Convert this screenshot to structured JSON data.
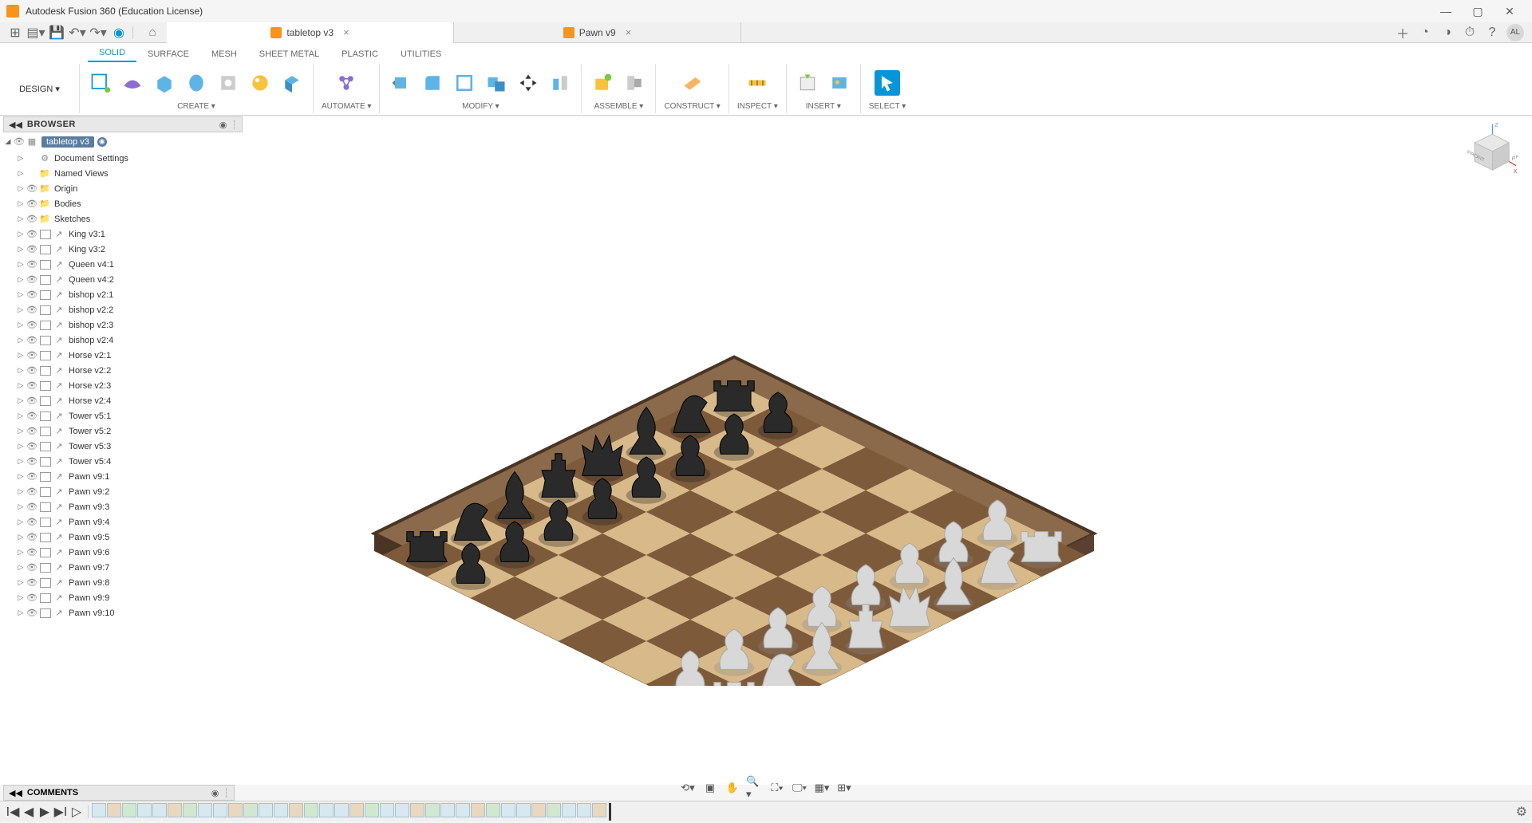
{
  "app": {
    "title": "Autodesk Fusion 360 (Education License)",
    "avatar": "AL"
  },
  "tabs": [
    {
      "label": "tabletop v3",
      "active": true
    },
    {
      "label": "Pawn v9",
      "active": false
    }
  ],
  "ribbon": {
    "design_label": "DESIGN ▾",
    "tabs": [
      "SOLID",
      "SURFACE",
      "MESH",
      "SHEET METAL",
      "PLASTIC",
      "UTILITIES"
    ],
    "active_tab": 0,
    "groups": {
      "create": "CREATE ▾",
      "automate": "AUTOMATE ▾",
      "modify": "MODIFY ▾",
      "assemble": "ASSEMBLE ▾",
      "construct": "CONSTRUCT ▾",
      "inspect": "INSPECT ▾",
      "insert": "INSERT ▾",
      "select": "SELECT ▾"
    }
  },
  "browser": {
    "title": "BROWSER",
    "root": "tabletop v3",
    "settings_items": [
      {
        "label": "Document Settings",
        "type": "gear"
      },
      {
        "label": "Named Views",
        "type": "folder"
      },
      {
        "label": "Origin",
        "type": "folder",
        "eye": true
      },
      {
        "label": "Bodies",
        "type": "folder",
        "eye": true
      },
      {
        "label": "Sketches",
        "type": "folder",
        "eye": true
      }
    ],
    "components": [
      "King v3:1",
      "King v3:2",
      "Queen v4:1",
      "Queen v4:2",
      "bishop v2:1",
      "bishop v2:2",
      "bishop v2:3",
      "bishop v2:4",
      "Horse v2:1",
      "Horse v2:2",
      "Horse v2:3",
      "Horse v2:4",
      "Tower v5:1",
      "Tower v5:2",
      "Tower v5:3",
      "Tower v5:4",
      "Pawn v9:1",
      "Pawn v9:2",
      "Pawn v9:3",
      "Pawn v9:4",
      "Pawn v9:5",
      "Pawn v9:6",
      "Pawn v9:7",
      "Pawn v9:8",
      "Pawn v9:9",
      "Pawn v9:10"
    ]
  },
  "comments": {
    "title": "COMMENTS"
  },
  "viewcube": {
    "front": "FRONT",
    "right": "RIGHT"
  },
  "timeline": {
    "op_count": 34
  },
  "chess": {
    "board_size": 8,
    "colors": {
      "light": "#d8b989",
      "dark": "#7d5a3a",
      "border_dark": "#4a3524",
      "border_light": "#8a6a4a"
    },
    "black_pieces_back": [
      "rook",
      "knight",
      "bishop",
      "queen",
      "king",
      "bishop",
      "knight",
      "rook"
    ],
    "white_pieces_back": [
      "rook",
      "knight",
      "bishop",
      "queen",
      "king",
      "bishop",
      "knight",
      "rook"
    ]
  }
}
